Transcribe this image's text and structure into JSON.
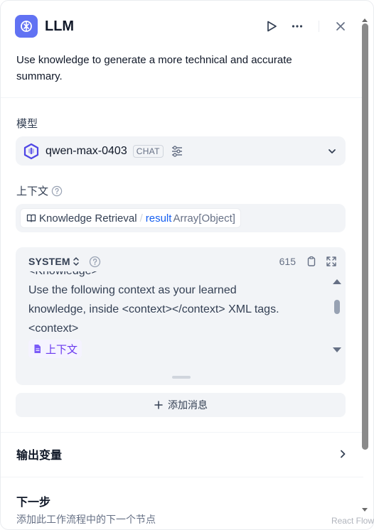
{
  "node": {
    "title": "LLM",
    "description": "Use knowledge to generate a more technical and accurate summary."
  },
  "header": {
    "run_icon": "play-icon",
    "more_icon": "more-horizontal-icon",
    "close_icon": "close-icon"
  },
  "model": {
    "label": "模型",
    "name": "qwen-max-0403",
    "mode_badge": "CHAT"
  },
  "context": {
    "label": "上下文",
    "variable": {
      "source": "Knowledge Retrieval",
      "separator": "/",
      "name": "result",
      "type": "Array[Object]"
    }
  },
  "system_prompt": {
    "role": "SYSTEM",
    "token_count": "615",
    "lines": [
      "<Knowledge>",
      "Use the following context as your learned",
      "knowledge, inside <context></context> XML tags.",
      "<context>"
    ],
    "context_var_label": "上下文"
  },
  "add_message": {
    "label": "添加消息"
  },
  "output": {
    "title": "输出变量"
  },
  "next_step": {
    "title": "下一步",
    "subtitle": "添加此工作流程中的下一个节点"
  },
  "watermark": "React Flow",
  "colors": {
    "accent": "#6172f3",
    "link": "#155eef",
    "context_var": "#6938ef"
  }
}
